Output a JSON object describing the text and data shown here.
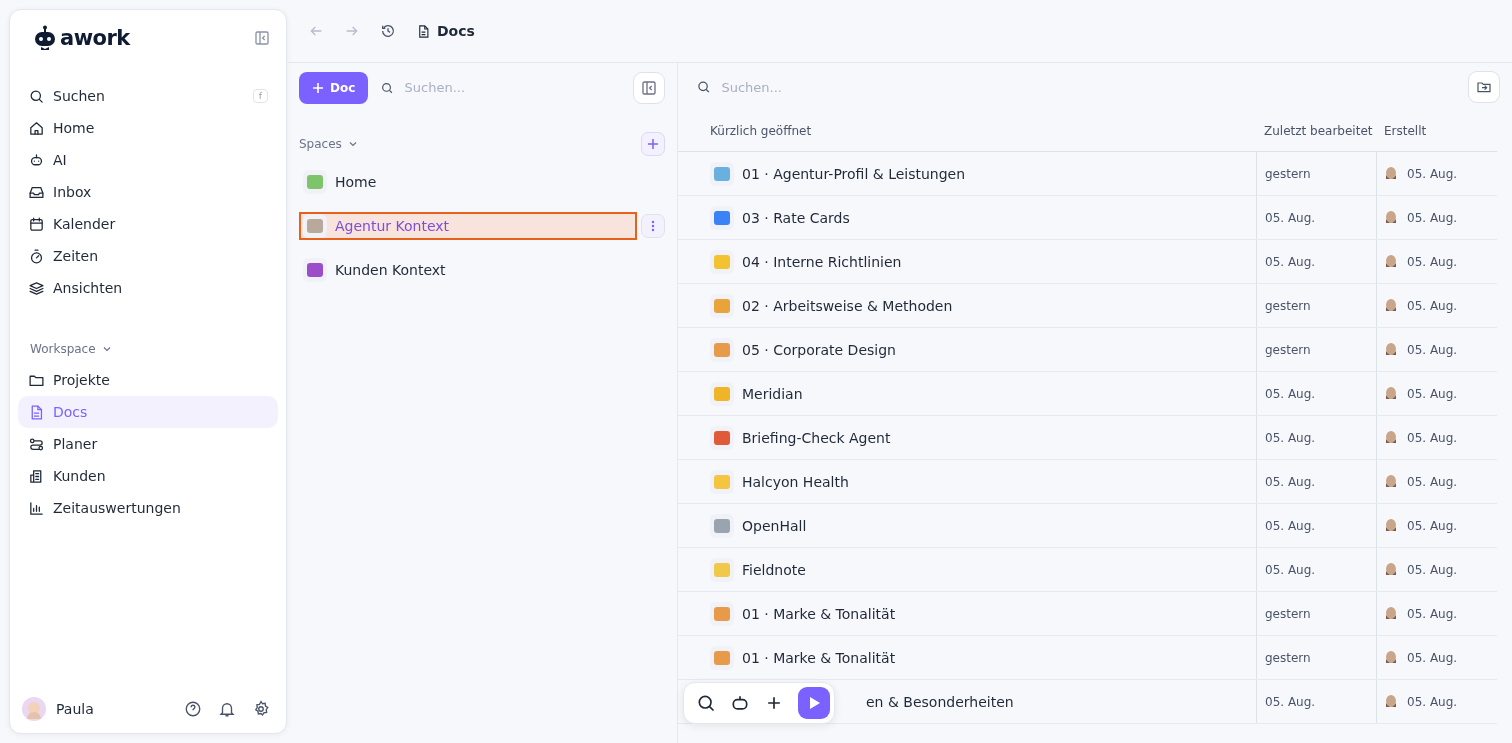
{
  "sidebar": {
    "logo": "awork",
    "shortcut": "f",
    "items": [
      {
        "label": "Suchen",
        "selected": false
      },
      {
        "label": "Home",
        "selected": false
      },
      {
        "label": "AI",
        "selected": false
      },
      {
        "label": "Inbox",
        "selected": false
      },
      {
        "label": "Kalender",
        "selected": false
      },
      {
        "label": "Zeiten",
        "selected": false
      },
      {
        "label": "Ansichten",
        "selected": false
      }
    ],
    "section": "Workspace",
    "workspace_items": [
      {
        "label": "Projekte",
        "selected": false
      },
      {
        "label": "Docs",
        "selected": true
      },
      {
        "label": "Planer",
        "selected": false
      },
      {
        "label": "Kunden",
        "selected": false
      },
      {
        "label": "Zeitauswertungen",
        "selected": false
      }
    ],
    "user": "Paula"
  },
  "topbar": {
    "title": "Docs"
  },
  "spaces_panel": {
    "new_button": "Doc",
    "search": {
      "placeholder": "Suchen..."
    },
    "section": "Spaces",
    "spaces": [
      {
        "label": "Home",
        "color": "#7dc46a",
        "selected": false
      },
      {
        "label": "Agentur Kontext",
        "color": "#b8a99a",
        "selected": true
      },
      {
        "label": "Kunden Kontext",
        "color": "#9b4dca",
        "selected": false
      }
    ]
  },
  "docs": {
    "search": {
      "placeholder": "Suchen..."
    },
    "columns": [
      "Kürzlich geöffnet",
      "Zuletzt bearbeitet",
      "Erstellt"
    ],
    "rows": [
      {
        "kind": "doc",
        "color": "#6ab0de",
        "title": "01 · Agentur-Profil & Leistungen",
        "edited": "gestern",
        "created": "05. Aug."
      },
      {
        "kind": "doc",
        "color": "#3b82f6",
        "title": "03 · Rate Cards",
        "edited": "05. Aug.",
        "created": "05. Aug."
      },
      {
        "kind": "doc",
        "color": "#f2c230",
        "title": "04 · Interne Richtlinien",
        "edited": "05. Aug.",
        "created": "05. Aug."
      },
      {
        "kind": "doc",
        "color": "#e8a33a",
        "title": "02 · Arbeitsweise & Methoden",
        "edited": "gestern",
        "created": "05. Aug."
      },
      {
        "kind": "doc",
        "color": "#e79a4a",
        "title": "05 · Corporate Design",
        "edited": "gestern",
        "created": "05. Aug."
      },
      {
        "kind": "doc",
        "color": "#f0b429",
        "title": "Meridian",
        "edited": "05. Aug.",
        "created": "05. Aug."
      },
      {
        "kind": "doc",
        "color": "#e05a3a",
        "title": "Briefing-Check Agent",
        "edited": "05. Aug.",
        "created": "05. Aug."
      },
      {
        "kind": "doc",
        "color": "#f5c542",
        "title": "Halcyon Health",
        "edited": "05. Aug.",
        "created": "05. Aug."
      },
      {
        "kind": "doc",
        "color": "#9aa4b1",
        "title": "OpenHall",
        "edited": "05. Aug.",
        "created": "05. Aug."
      },
      {
        "kind": "doc",
        "color": "#f0c94a",
        "title": "Fieldnote",
        "edited": "05. Aug.",
        "created": "05. Aug."
      },
      {
        "kind": "doc",
        "color": "#e79a4a",
        "title": "01 · Marke & Tonalität",
        "edited": "gestern",
        "created": "05. Aug."
      },
      {
        "kind": "doc",
        "color": "#e79a4a",
        "title": "01 · Marke & Tonalität",
        "edited": "gestern",
        "created": "05. Aug."
      },
      {
        "kind": "covered",
        "title": "en & Besonderheiten",
        "edited": "05. Aug.",
        "created": "05. Aug."
      }
    ]
  }
}
